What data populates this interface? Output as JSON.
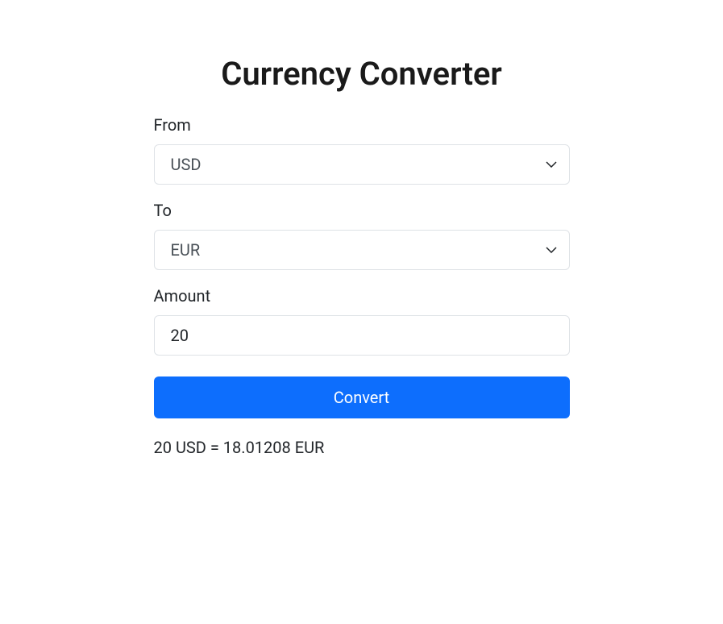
{
  "title": "Currency Converter",
  "form": {
    "from": {
      "label": "From",
      "value": "USD"
    },
    "to": {
      "label": "To",
      "value": "EUR"
    },
    "amount": {
      "label": "Amount",
      "value": "20"
    },
    "convert_label": "Convert"
  },
  "result": "20 USD = 18.01208 EUR"
}
